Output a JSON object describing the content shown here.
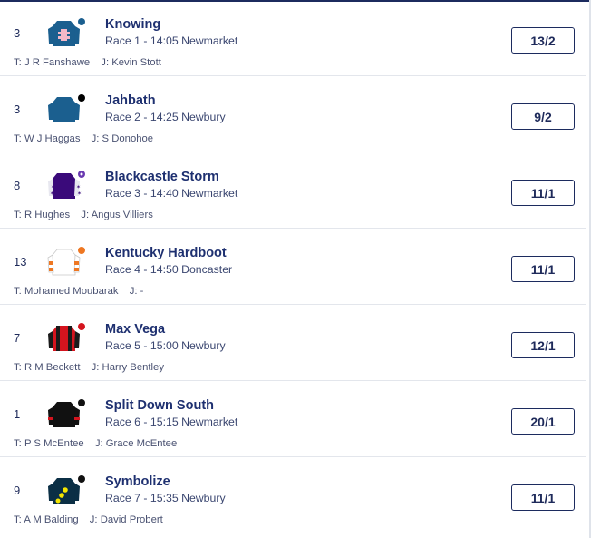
{
  "runners": [
    {
      "number": "3",
      "name": "Knowing",
      "race": "Race 1 - 14:05 Newmarket",
      "trainer_label": "T:",
      "trainer": "J R Fanshawe",
      "jockey_label": "J:",
      "jockey": "Kevin Stott",
      "odds": "13/2",
      "silk": "knowing"
    },
    {
      "number": "3",
      "name": "Jahbath",
      "race": "Race 2 - 14:25 Newbury",
      "trainer_label": "T:",
      "trainer": "W J Haggas",
      "jockey_label": "J:",
      "jockey": "S Donohoe",
      "odds": "9/2",
      "silk": "jahbath"
    },
    {
      "number": "8",
      "name": "Blackcastle Storm",
      "race": "Race 3 - 14:40 Newmarket",
      "trainer_label": "T:",
      "trainer": "R Hughes",
      "jockey_label": "J:",
      "jockey": "Angus Villiers",
      "odds": "11/1",
      "silk": "blackcastle"
    },
    {
      "number": "13",
      "name": "Kentucky Hardboot",
      "race": "Race 4 - 14:50 Doncaster",
      "trainer_label": "T:",
      "trainer": "Mohamed Moubarak",
      "jockey_label": "J:",
      "jockey": "-",
      "odds": "11/1",
      "silk": "kentucky"
    },
    {
      "number": "7",
      "name": "Max Vega",
      "race": "Race 5 - 15:00 Newbury",
      "trainer_label": "T:",
      "trainer": "R M Beckett",
      "jockey_label": "J:",
      "jockey": "Harry Bentley",
      "odds": "12/1",
      "silk": "maxvega"
    },
    {
      "number": "1",
      "name": "Split Down South",
      "race": "Race 6 - 15:15 Newmarket",
      "trainer_label": "T:",
      "trainer": "P S McEntee",
      "jockey_label": "J:",
      "jockey": "Grace McEntee",
      "odds": "20/1",
      "silk": "splitdown"
    },
    {
      "number": "9",
      "name": "Symbolize",
      "race": "Race 7 - 15:35 Newbury",
      "trainer_label": "T:",
      "trainer": "A M Balding",
      "jockey_label": "J:",
      "jockey": "David Probert",
      "odds": "11/1",
      "silk": "symbolize"
    }
  ]
}
